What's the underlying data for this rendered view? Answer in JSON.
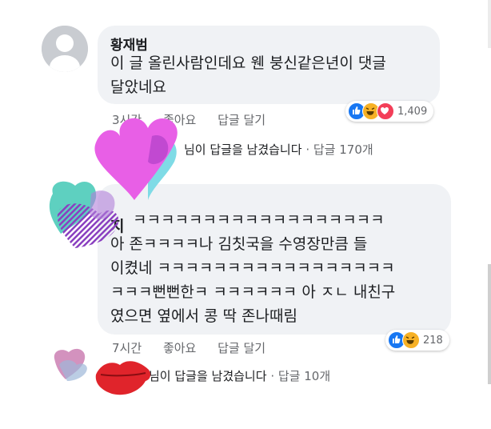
{
  "comment1": {
    "author": "황재범",
    "text": "이 글 올린사람인데요 웬 붕신같은년이 댓글\n달았네요",
    "time": "3시간",
    "like": "좋아요",
    "reply": "답글 달기",
    "reaction_count": "1,409",
    "replies_summary": "님이 답글을 남겼습니다",
    "replies_count": "· 답글 170개"
  },
  "comment2": {
    "author_partial": "지",
    "text": "ㅋㅋㅋㅋㅋㅋㅋㅋㅋㅋㅋㅋㅋㅋㅋㅋㅋㅋ\n아 존ㅋㅋㅋㅋ나 김칫국을 수영장만큼 들\n이켰네 ㅋㅋㅋㅋㅋㅋㅋㅋㅋㅋㅋㅋㅋㅋㅋㅋㅋ\nㅋㅋㅋ뻔뻔한ㅋ ㅋㅋㅋㅋㅋㅋ 아 ㅈㄴ 내친구\n였으면 옆에서 콩 딱 존나때림",
    "time": "7시간",
    "like": "좋아요",
    "reply": "답글 달기",
    "reaction_count": "218",
    "replies_summary": "님이 답글을 남겼습니다",
    "replies_count": "· 답글 10개"
  },
  "colors": {
    "like_blue": "#1877f2",
    "haha_yellow": "#f7b125",
    "love_red": "#f33e58",
    "bubble_gray": "#f0f2f5",
    "sticker_magenta": "#e85fe6",
    "sticker_cyan": "#7fdbe6",
    "sticker_purple": "#8a3fc0",
    "sticker_red": "#e0242b"
  },
  "icons": {
    "like": "like-reaction-icon",
    "haha": "haha-reaction-icon",
    "love": "love-reaction-icon"
  }
}
